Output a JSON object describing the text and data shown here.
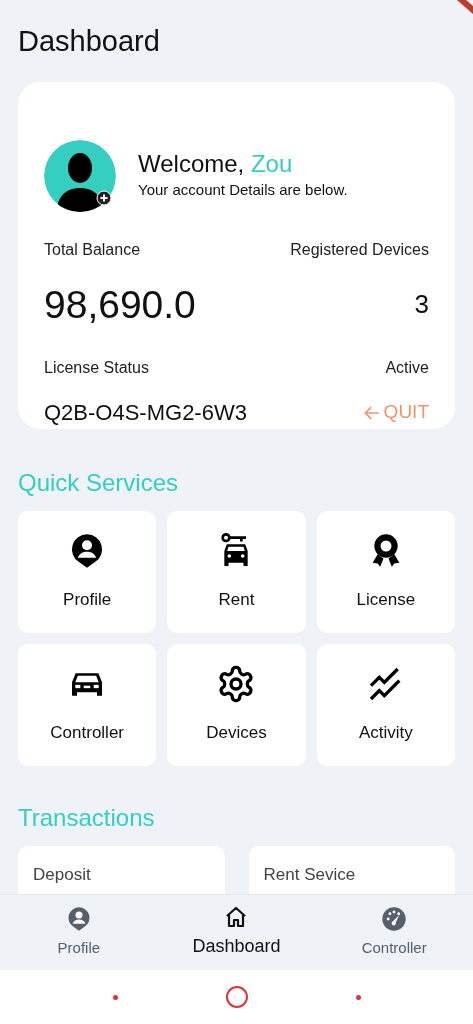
{
  "title": "Dashboard",
  "account": {
    "greeting": "Welcome, ",
    "name": "Zou",
    "subtitle": "Your account Details are below.",
    "balance_label": "Total Balance",
    "balance": "98,690.0",
    "devices_label": "Registered Devices",
    "devices": "3",
    "license_label": "License Status",
    "license_status": "Active",
    "license_key": "Q2B-O4S-MG2-6W3",
    "quit": "QUIT"
  },
  "quick_services": {
    "title": "Quick Services",
    "items": [
      {
        "label": "Profile",
        "kind": "profile"
      },
      {
        "label": "Rent",
        "kind": "rent"
      },
      {
        "label": "License",
        "kind": "license"
      },
      {
        "label": "Controller",
        "kind": "controller"
      },
      {
        "label": "Devices",
        "kind": "devices"
      },
      {
        "label": "Activity",
        "kind": "activity"
      }
    ]
  },
  "transactions": {
    "title": "Transactions",
    "items": [
      "Deposit",
      "Rent Sevice"
    ]
  },
  "bottom_nav": [
    {
      "label": "Profile",
      "kind": "profile",
      "selected": false
    },
    {
      "label": "Dashboard",
      "kind": "home",
      "selected": true
    },
    {
      "label": "Controller",
      "kind": "gauge",
      "selected": false
    }
  ]
}
